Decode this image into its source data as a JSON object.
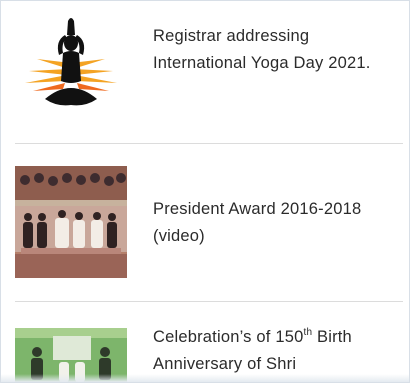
{
  "news": {
    "items": [
      {
        "title": "Registrar addressing International Yoga Day 2021.",
        "thumbnail_icon": "yoga-meditation-icon"
      },
      {
        "title": "President Award 2016-2018 (video)",
        "thumbnail_icon": "award-ceremony-photo"
      },
      {
        "title_prefix": "Celebration’s of 150",
        "title_sup": "th",
        "title_suffix": " Birth Anniversary of Shri",
        "thumbnail_icon": "celebration-photo"
      }
    ]
  },
  "colors": {
    "title_text": "#2b2b2b",
    "divider": "#dcdcdc",
    "frame_border": "#d8dfe7"
  }
}
